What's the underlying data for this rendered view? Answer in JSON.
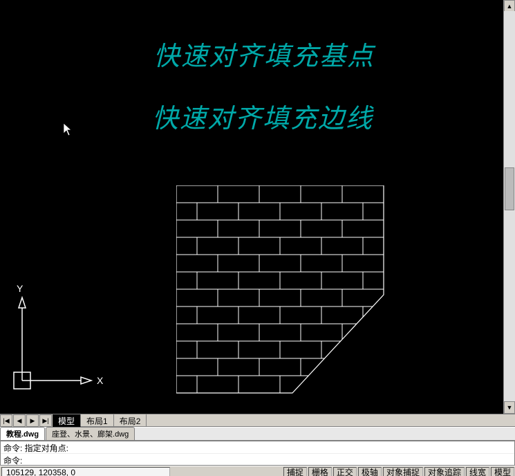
{
  "viewport": {
    "text1": "快速对齐填充基点",
    "text2": "快速对齐填充边线",
    "ucs_x_label": "X",
    "ucs_y_label": "Y"
  },
  "layout_tabs": {
    "nav": {
      "first": "|◀",
      "prev": "◀",
      "next": "▶",
      "last": "▶|"
    },
    "items": [
      {
        "label": "模型",
        "active": true
      },
      {
        "label": "布局1",
        "active": false
      },
      {
        "label": "布局2",
        "active": false
      }
    ]
  },
  "file_tabs": {
    "items": [
      {
        "label": "教程.dwg",
        "active": true
      },
      {
        "label": "座登、水景、廊架.dwg",
        "active": false
      }
    ]
  },
  "command_window": {
    "line1": "命令:  指定对角点:",
    "line2": "命令:"
  },
  "status": {
    "coords": "105129, 120358, 0",
    "toggles": [
      "捕捉",
      "栅格",
      "正交",
      "极轴",
      "对象捕捉",
      "对象追踪",
      "线宽",
      "模型"
    ]
  }
}
